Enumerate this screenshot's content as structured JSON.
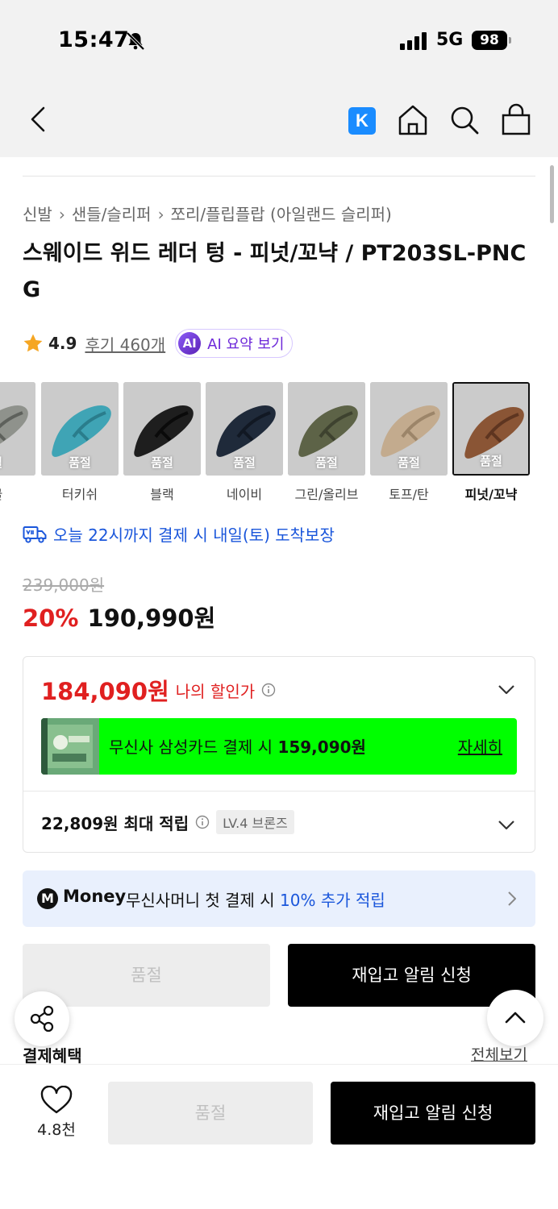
{
  "status_bar": {
    "time": "15:47",
    "network": "5G",
    "battery": "98"
  },
  "header": {
    "k_label": "K"
  },
  "breadcrumb": [
    "신발",
    "샌들/슬리퍼",
    "쪼리/플립플랍 (아일랜드 슬리퍼)"
  ],
  "product": {
    "title": "스웨이드 위드 레더 텅 - 피넛/꼬냑 / PT203SL-PNCG",
    "rating": "4.9",
    "reviews": "후기 460개",
    "ai_badge": "AI",
    "ai_label": "AI 요약 보기"
  },
  "colors": [
    {
      "name": "골",
      "soldout": "절",
      "fill": "#8f928c",
      "dark": "#5e615c"
    },
    {
      "name": "터키쉬",
      "soldout": "품절",
      "fill": "#3fa4b5",
      "dark": "#2a7d8c"
    },
    {
      "name": "블랙",
      "soldout": "품절",
      "fill": "#1e1e1e",
      "dark": "#0a0a0a"
    },
    {
      "name": "네이비",
      "soldout": "품절",
      "fill": "#1f2a3a",
      "dark": "#111823"
    },
    {
      "name": "그린/올리브",
      "soldout": "품절",
      "fill": "#5d6347",
      "dark": "#3e422f"
    },
    {
      "name": "토프/탄",
      "soldout": "품절",
      "fill": "#c3ab8e",
      "dark": "#9c8569"
    },
    {
      "name": "피넛/꼬냑",
      "soldout": "품절",
      "fill": "#8a5535",
      "dark": "#5e3520",
      "selected": true
    }
  ],
  "delivery": "오늘 22시까지 결제 시 내일(토) 도착보장",
  "price": {
    "original": "239,000원",
    "discount": "20%",
    "sale": "190,990원"
  },
  "my_price": {
    "amount": "184,090원",
    "label": "나의 할인가"
  },
  "samsung": {
    "text": "무신사 삼성카드 결제 시 ",
    "amount": "159,090원",
    "link": "자세히"
  },
  "points": {
    "amount": "22,809원 최대 적립",
    "level": "LV.4 브론즈"
  },
  "money_banner": {
    "logo": "M",
    "brand": "Money",
    "text": "무신사머니 첫 결제 시 ",
    "highlight": "10% 추가 적립"
  },
  "actions": {
    "soldout": "품절",
    "restock": "재입고 알림 신청"
  },
  "benefits": {
    "title": "결제혜택",
    "view_all": "전체보기"
  },
  "bottom_bar": {
    "likes": "4.8천",
    "soldout": "품절",
    "restock": "재입고 알림 신청"
  },
  "accent_colors": {
    "red": "#e02020",
    "blue": "#1a56db",
    "green": "#00ff00",
    "purple": "#6d28d9"
  }
}
